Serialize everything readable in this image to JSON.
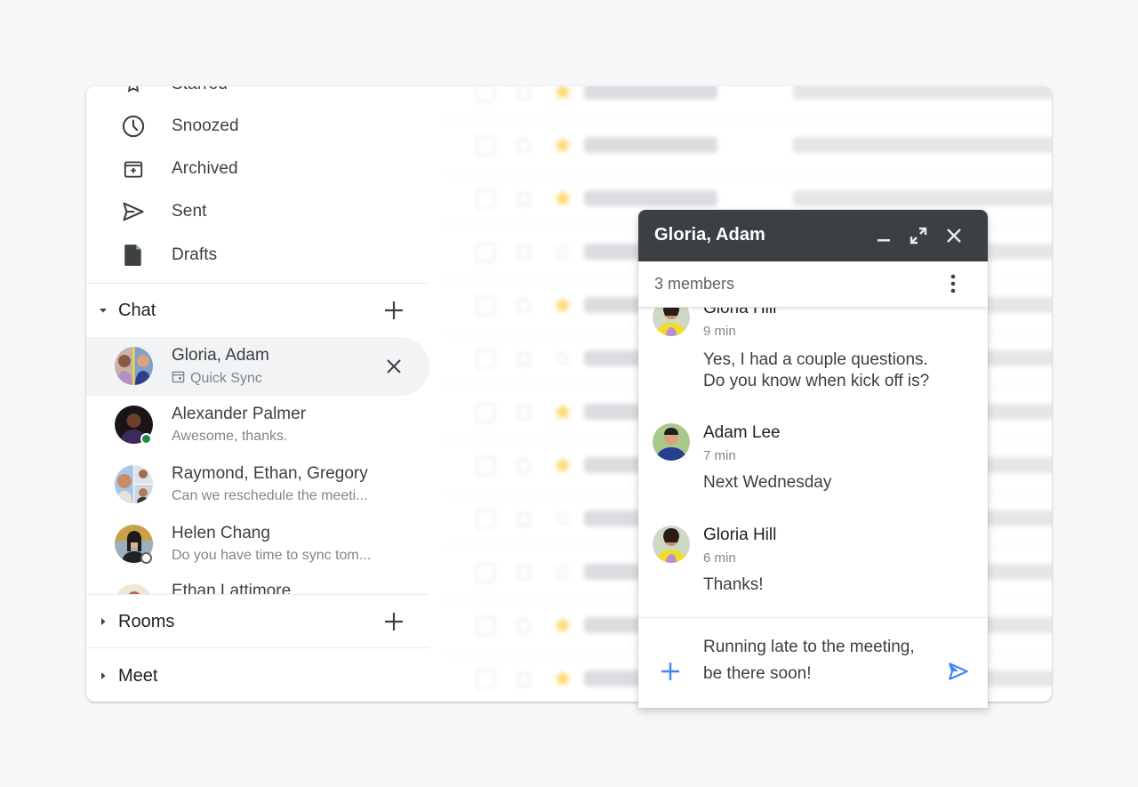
{
  "colors": {
    "accent": "#4285f4",
    "online": "#1e8e3e",
    "star": "#fbbc04",
    "chat_header_bg": "#3c4043",
    "selected_bg": "#f1f3f4"
  },
  "sidebar": {
    "nav": [
      {
        "label": "Starred",
        "icon": "star-outline-icon"
      },
      {
        "label": "Snoozed",
        "icon": "clock-icon"
      },
      {
        "label": "Archived",
        "icon": "archive-icon"
      },
      {
        "label": "Sent",
        "icon": "send-icon"
      },
      {
        "label": "Drafts",
        "icon": "draft-icon"
      }
    ],
    "chat_section": {
      "title": "Chat",
      "expanded": true,
      "items": [
        {
          "name": "Gloria, Adam",
          "subtitle": "Quick Sync",
          "subtitle_icon": "calendar-icon",
          "active": true
        },
        {
          "name": "Alexander Palmer",
          "subtitle": "Awesome, thanks.",
          "status": "online"
        },
        {
          "name": "Raymond, Ethan, Gregory",
          "subtitle": "Can we reschedule the meeti..."
        },
        {
          "name": "Helen Chang",
          "subtitle": "Do you have time to sync tom...",
          "status": "away"
        },
        {
          "name": "Ethan Lattimore",
          "subtitle": ""
        }
      ]
    },
    "rooms_section": {
      "title": "Rooms",
      "expanded": false
    },
    "meet_section": {
      "title": "Meet",
      "expanded": false
    }
  },
  "mail_list": {
    "rows": [
      {
        "starred": true
      },
      {
        "starred": true
      },
      {
        "starred": true
      },
      {
        "starred": false
      },
      {
        "starred": true
      },
      {
        "starred": false
      },
      {
        "starred": true
      },
      {
        "starred": true
      },
      {
        "starred": false
      },
      {
        "starred": false
      },
      {
        "starred": true
      },
      {
        "starred": true
      }
    ]
  },
  "chat_window": {
    "title": "Gloria, Adam",
    "members": "3 members",
    "messages": [
      {
        "sender": "Gloria Hill",
        "time": "9 min",
        "lines": [
          "Yes, I had a couple questions.",
          "Do you know when kick off is?"
        ]
      },
      {
        "sender": "Adam Lee",
        "time": "7 min",
        "lines": [
          "Next Wednesday"
        ]
      },
      {
        "sender": "Gloria Hill",
        "time": "6 min",
        "lines": [
          "Thanks!"
        ]
      }
    ],
    "composer": {
      "value": "Running late to the meeting, be there soon!"
    }
  }
}
